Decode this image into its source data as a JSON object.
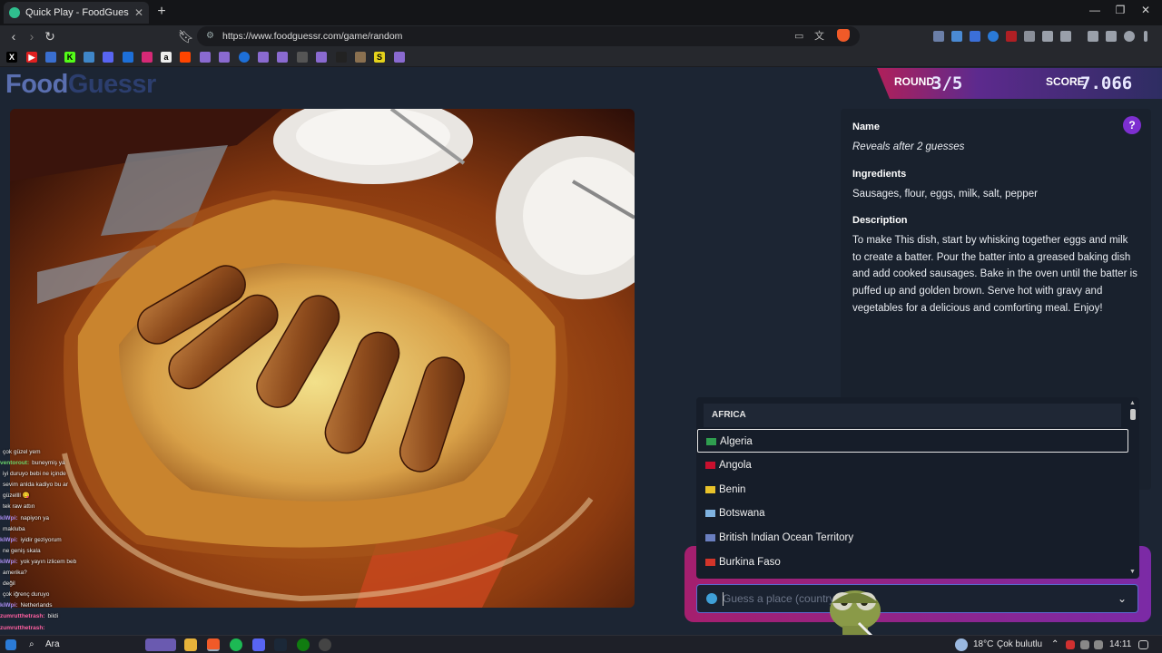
{
  "browser": {
    "tab_title": "Quick Play - FoodGuessr | Food",
    "tab_close": "✕",
    "new_tab": "+",
    "url": "https://www.foodguessr.com/game/random",
    "controls": {
      "minimize": "—",
      "maximize": "❐",
      "close": "✕"
    }
  },
  "header": {
    "logo_part1": "Food",
    "logo_part2": "Guessr",
    "round_label": "ROUND",
    "round_value": "3/5",
    "score_label": "SCORE",
    "score_value": "7.066"
  },
  "info": {
    "name_heading": "Name",
    "name_value": "Reveals after 2 guesses",
    "ingredients_heading": "Ingredients",
    "ingredients_value": "Sausages, flour, eggs, milk, salt, pepper",
    "description_heading": "Description",
    "description_value": "To make This dish, start by whisking together eggs and milk to create a batter. Pour the batter into a greased baking dish and add cooked sausages. Bake in the oven until the batter is puffed up and golden brown. Serve hot with gravy and vegetables for a delicious and comforting meal. Enjoy!",
    "help_icon": "?"
  },
  "dropdown": {
    "group": "AFRICA",
    "options": [
      {
        "label": "Algeria",
        "flag_color": "#2f9e4f"
      },
      {
        "label": "Angola",
        "flag_color": "#c8102e"
      },
      {
        "label": "Benin",
        "flag_color": "#e8c22a"
      },
      {
        "label": "Botswana",
        "flag_color": "#7fb2e0"
      },
      {
        "label": "British Indian Ocean Territory",
        "flag_color": "#6a7fc0"
      },
      {
        "label": "Burkina Faso",
        "flag_color": "#d2352a"
      }
    ]
  },
  "guess": {
    "placeholder": "Guess a place (country...)",
    "chevron": "⌄"
  },
  "chat": [
    {
      "user": "",
      "msg": "çok güzel yem",
      "color": "#e0a94b"
    },
    {
      "user": "ventorout:",
      "msg": "buneymiş ya",
      "color": "#6ad36a"
    },
    {
      "user": "",
      "msg": "iyi duruyo bebi ne içinde",
      "color": "#e0a94b"
    },
    {
      "user": "",
      "msg": "sevim anlda kadiyo bu ar",
      "color": "#e0a94b"
    },
    {
      "user": "",
      "msg": "güzellll 😋",
      "color": "#e0a94b"
    },
    {
      "user": "",
      "msg": "tek raw attın",
      "color": "#e0a94b"
    },
    {
      "user": "kiWpi:",
      "msg": "napiyon ya",
      "color": "#a98cf0"
    },
    {
      "user": "",
      "msg": "makluba",
      "color": "#e0a94b"
    },
    {
      "user": "kiWpi:",
      "msg": "iyidir geziyorum",
      "color": "#a98cf0"
    },
    {
      "user": "",
      "msg": "ne geniş skala",
      "color": "#e0a94b"
    },
    {
      "user": "kiWpi:",
      "msg": "yok yayın izlicem beb",
      "color": "#a98cf0"
    },
    {
      "user": "",
      "msg": "amerika?",
      "color": "#e0a94b"
    },
    {
      "user": "",
      "msg": "değil",
      "color": "#e0a94b"
    },
    {
      "user": "",
      "msg": "çok iğrenç duruyo",
      "color": "#e0a94b"
    },
    {
      "user": "kiWpi:",
      "msg": "Netherlands",
      "color": "#a98cf0"
    },
    {
      "user": "zumrutthetrash:",
      "msg": "bildi",
      "color": "#ff5fa0"
    },
    {
      "user": "zumrutthetrash:",
      "msg": "",
      "color": "#ff5fa0"
    }
  ],
  "taskbar": {
    "search": "Ara",
    "weather": "18°C",
    "weather_desc": "Çok bulutlu",
    "time": "14:11"
  }
}
